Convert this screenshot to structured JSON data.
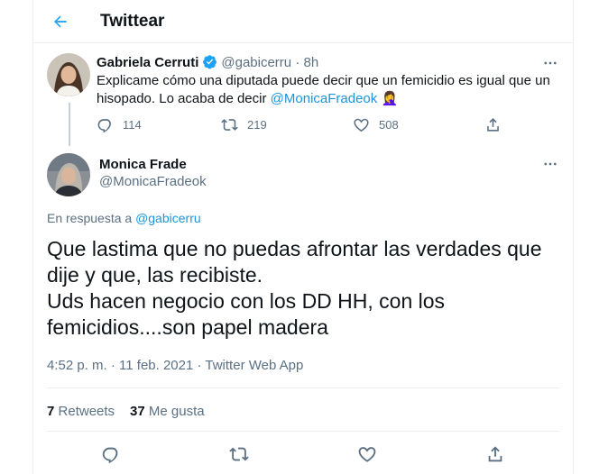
{
  "header": {
    "title": "Twittear"
  },
  "quoted_tweet": {
    "display_name": "Gabriela Cerruti",
    "handle": "@gabicerru",
    "separator": "·",
    "time": "8h",
    "text": "Explicame cómo una diputada puede decir que un femicidio es igual que un hisopado. Lo acaba de decir ",
    "mention": "@MonicaFradeok",
    "emoji": "🤦‍♀️",
    "replies": "114",
    "retweets": "219",
    "likes": "508"
  },
  "main_tweet": {
    "display_name": "Monica Frade",
    "handle": "@MonicaFradeok",
    "reply_prefix": "En respuesta a ",
    "reply_to": "@gabicerru",
    "text": "Que lastima que no puedas afrontar las verdades que dije y que, las recibiste.\nUds hacen negocio con los DD HH, con los femicidios....son papel madera",
    "timestamp": "4:52 p. m. · 11 feb. 2021 · Twitter Web App",
    "retweets_count": "7",
    "retweets_label": "Retweets",
    "likes_count": "37",
    "likes_label": "Me gusta"
  },
  "icons": {
    "back": "arrow-left-icon",
    "verified": "verified-badge-icon",
    "more": "more-horizontal-icon",
    "reply": "reply-icon",
    "retweet": "retweet-icon",
    "like": "heart-icon",
    "share": "share-icon"
  },
  "colors": {
    "accent": "#1da1f2",
    "link": "#1b95e0",
    "muted": "#5b7083",
    "border": "#ebeef0"
  }
}
